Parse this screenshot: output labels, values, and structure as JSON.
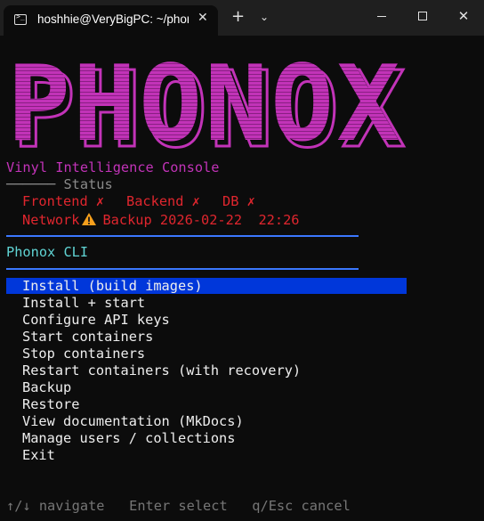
{
  "window": {
    "tab_title": "hoshhie@VeryBigPC: ~/phonox",
    "tab_close": "✕",
    "new_tab": "+",
    "dropdown": "⌄",
    "win_close": "✕"
  },
  "colors": {
    "accent": "#c233b8",
    "selection": "#0037da",
    "rule": "#3b78ff",
    "error": "#e0262e",
    "heading": "#60d4d4"
  },
  "logo": {
    "text": "PHONOX"
  },
  "subtitle": "Vinyl Intelligence Console",
  "status": {
    "header": "────── Status",
    "frontend": "Frontend ✗",
    "backend": "Backend ✗",
    "db": "DB ✗",
    "network_label": "Network",
    "network_icon": "warning-icon",
    "backup": "Backup 2026-02-22  22:26"
  },
  "section_title": "Phonox CLI",
  "menu": {
    "selected_index": 0,
    "items": [
      "Install (build images)",
      "Install + start",
      "Configure API keys",
      "Start containers",
      "Stop containers",
      "Restart containers (with recovery)",
      "Backup",
      "Restore",
      "View documentation (MkDocs)",
      "Manage users / collections",
      "Exit"
    ]
  },
  "help": "↑/↓ navigate   Enter select   q/Esc cancel"
}
